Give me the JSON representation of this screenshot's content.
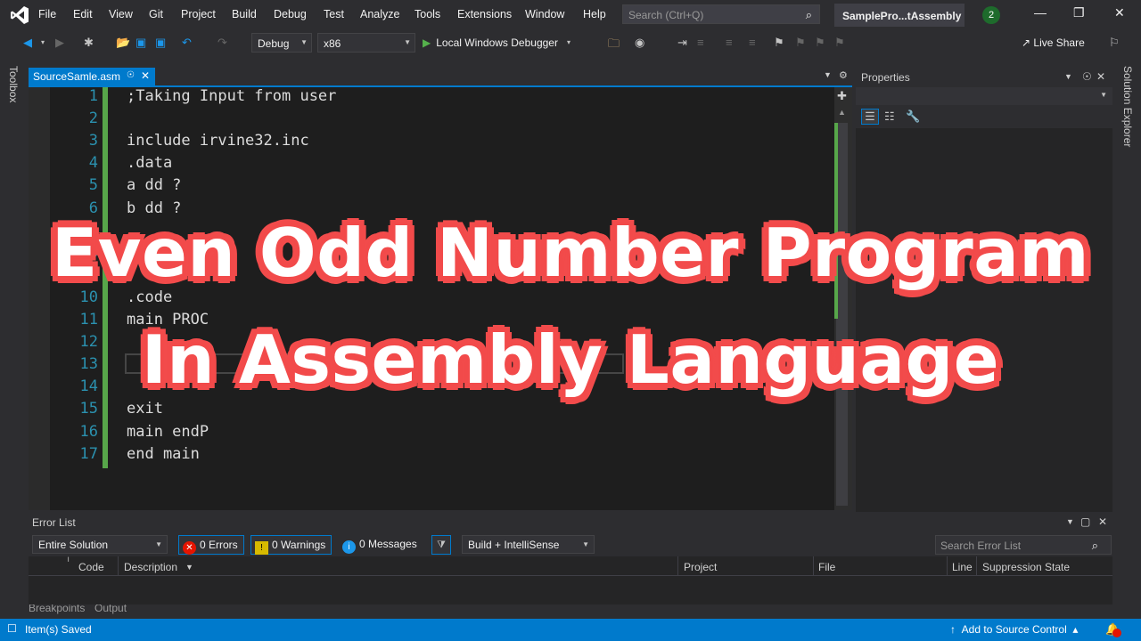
{
  "menu": [
    "File",
    "Edit",
    "View",
    "Git",
    "Project",
    "Build",
    "Debug",
    "Test",
    "Analyze",
    "Tools",
    "Extensions",
    "Window",
    "Help"
  ],
  "search": {
    "placeholder": "Search (Ctrl+Q)"
  },
  "solution_name": "SamplePro...tAssembly",
  "notification_count": "2",
  "toolbar": {
    "configuration": "Debug",
    "platform": "x86",
    "run_label": "Local Windows Debugger",
    "live_share": "Live Share"
  },
  "side_strips": {
    "left": "Toolbox",
    "right": "Solution Explorer"
  },
  "editor": {
    "tab_name": "SourceSamle.asm",
    "lines": [
      {
        "no": "1",
        "text": ";Taking Input from user"
      },
      {
        "no": "2",
        "text": ""
      },
      {
        "no": "3",
        "text": "include irvine32.inc"
      },
      {
        "no": "4",
        "text": ".data"
      },
      {
        "no": "5",
        "text": "a dd ?"
      },
      {
        "no": "6",
        "text": "b dd ?"
      },
      {
        "no": "7",
        "text": ""
      },
      {
        "no": "8",
        "text": ""
      },
      {
        "no": "9",
        "text": ""
      },
      {
        "no": "10",
        "text": ".code"
      },
      {
        "no": "11",
        "text": "main PROC"
      },
      {
        "no": "12",
        "text": ""
      },
      {
        "no": "13",
        "text": ""
      },
      {
        "no": "14",
        "text": ""
      },
      {
        "no": "15",
        "text": "exit"
      },
      {
        "no": "16",
        "text": "main endP"
      },
      {
        "no": "17",
        "text": "end main"
      }
    ]
  },
  "properties": {
    "title": "Properties"
  },
  "error_list": {
    "title": "Error List",
    "scope": "Entire Solution",
    "errors": "0 Errors",
    "warnings": "0 Warnings",
    "messages": "0 Messages",
    "source": "Build + IntelliSense",
    "search_placeholder": "Search Error List",
    "columns": [
      "Code",
      "Description",
      "Project",
      "File",
      "Line",
      "Suppression State"
    ]
  },
  "bottom_tabs": [
    "Breakpoints",
    "Output"
  ],
  "status": {
    "text": "Item(s) Saved",
    "add_source_control": "Add to Source Control"
  },
  "overlay": {
    "line1": "Even Odd Number Program",
    "line2": "In Assembly Language"
  },
  "colors": {
    "accent": "#007acc",
    "overlay_outline": "#f24b4b",
    "line_numbers": "#2b91af",
    "change_bar": "#57a64a"
  }
}
